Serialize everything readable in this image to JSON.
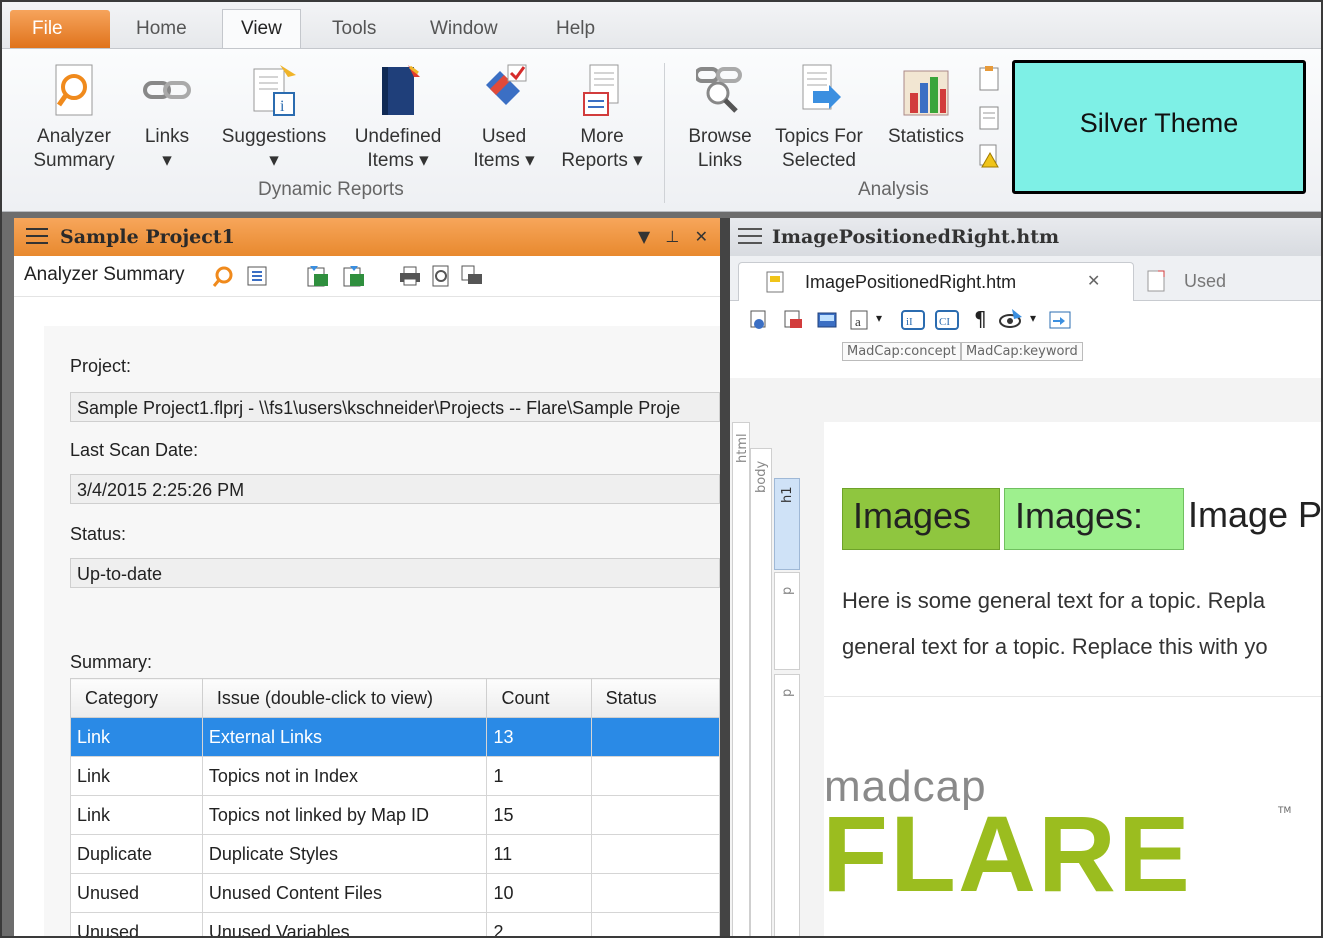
{
  "ribbon_tabs": [
    "File",
    "Home",
    "View",
    "Tools",
    "Window",
    "Help"
  ],
  "ribbon": {
    "dynamic_reports": {
      "label": "Dynamic Reports",
      "buttons": [
        {
          "l1": "Analyzer",
          "l2": "Summary"
        },
        {
          "l1": "Links",
          "l2": "▾"
        },
        {
          "l1": "Suggestions",
          "l2": "▾"
        },
        {
          "l1": "Undefined",
          "l2": "Items ▾"
        },
        {
          "l1": "Used",
          "l2": "Items ▾"
        },
        {
          "l1": "More",
          "l2": "Reports ▾"
        }
      ]
    },
    "analysis": {
      "label": "Analysis",
      "buttons": [
        {
          "l1": "Browse",
          "l2": "Links"
        },
        {
          "l1": "Topics For",
          "l2": "Selected"
        },
        {
          "l1": "Statistics",
          "l2": ""
        }
      ]
    },
    "overlay_label": "Silver Theme"
  },
  "left_pane": {
    "title": "Sample Project1",
    "toolbar_label": "Analyzer Summary",
    "project_label": "Project:",
    "project_value": "Sample Project1.flprj - \\\\fs1\\users\\kschneider\\Projects -- Flare\\Sample Proje",
    "scan_label": "Last Scan Date:",
    "scan_value": "3/4/2015 2:25:26 PM",
    "status_label": "Status:",
    "status_value": "Up-to-date",
    "summary_label": "Summary:",
    "table": {
      "headers": [
        "Category",
        "Issue (double-click to view)",
        "Count",
        "Status"
      ],
      "rows": [
        [
          "Link",
          "External Links",
          "13",
          ""
        ],
        [
          "Link",
          "Topics not in Index",
          "1",
          ""
        ],
        [
          "Link",
          "Topics not linked by Map ID",
          "15",
          ""
        ],
        [
          "Duplicate",
          "Duplicate Styles",
          "11",
          ""
        ],
        [
          "Unused",
          "Unused Content Files",
          "10",
          ""
        ],
        [
          "Unused",
          "Unused Variables",
          "2",
          ""
        ]
      ]
    }
  },
  "right_pane": {
    "title": "ImagePositionedRight.htm",
    "tab_active": "ImagePositionedRight.htm",
    "tab_inactive": "Used Variables",
    "tags": [
      "MadCap:concept",
      "MadCap:keyword"
    ],
    "rail_html": "html",
    "rail_body": "body",
    "rail_h1": "h1",
    "rail_p1": "p",
    "rail_p2": "p",
    "heading_tag1": "Images",
    "heading_tag2": "Images: positio",
    "heading_text": "Image P",
    "para_line1": "Here is some general text for a topic. Repla",
    "para_line2": "general text for a topic. Replace this with yo",
    "logo_top": "madcap",
    "logo_bottom": "FLARE",
    "logo_tm": "TM"
  },
  "colors": {
    "accent_orange": "#e8892e",
    "selection_blue": "#2a8ae6",
    "silver_overlay": "#7ef0e6",
    "flare_green": "#9bbd1f"
  }
}
